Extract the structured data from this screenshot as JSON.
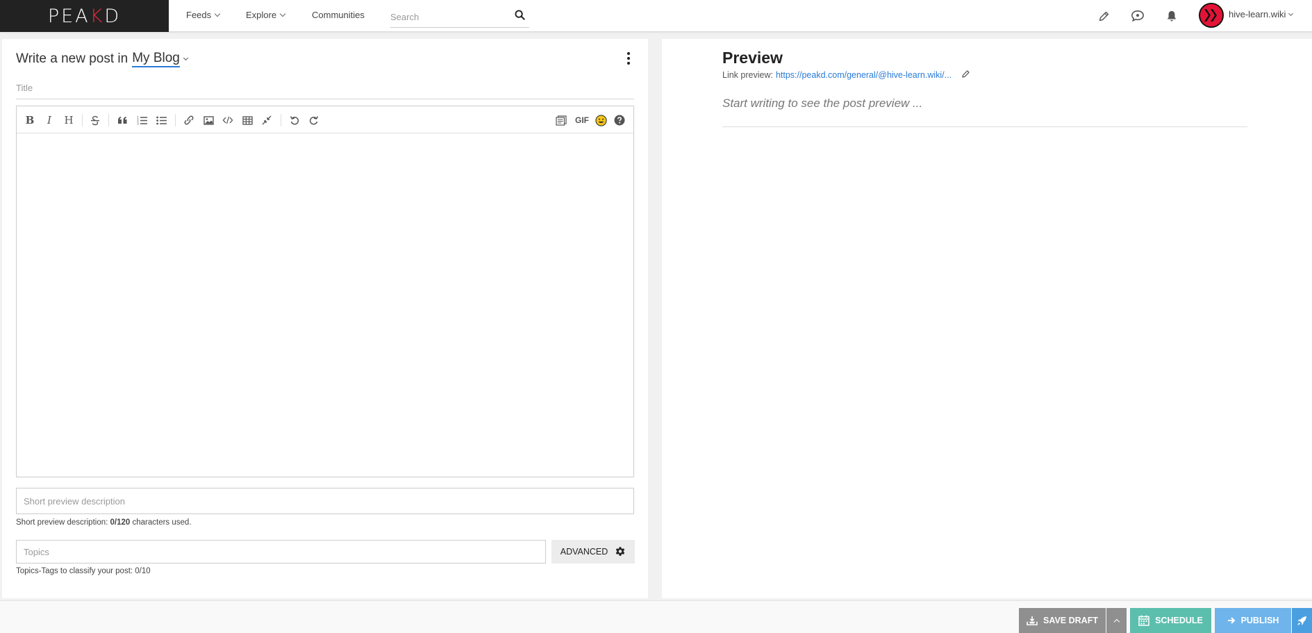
{
  "brand": {
    "logo_prefix": "PE",
    "logo_mark": "A",
    "logo_k": "K",
    "logo_suffix": "D",
    "accent_color": "#e8283d"
  },
  "nav": {
    "items": [
      {
        "label": "Feeds",
        "has_dropdown": true
      },
      {
        "label": "Explore",
        "has_dropdown": true
      },
      {
        "label": "Communities",
        "has_dropdown": false
      }
    ],
    "search_placeholder": "Search",
    "icons": [
      "pencil-icon",
      "chat-icon",
      "bell-icon"
    ],
    "username": "hive-learn.wiki"
  },
  "editor": {
    "heading_prefix": "Write a new post in",
    "blog_target": "My Blog",
    "title_placeholder": "Title",
    "toolbar": [
      "bold",
      "italic",
      "heading",
      "strikethrough",
      "quote",
      "ordered-list",
      "unordered-list",
      "link",
      "image",
      "code",
      "table",
      "fullscreen",
      "undo",
      "redo",
      "snippets",
      "gif",
      "emoji",
      "help"
    ],
    "toolbar_labels": {
      "bold": "B",
      "italic": "I",
      "heading": "H",
      "gif": "GIF"
    },
    "short_desc_placeholder": "Short preview description",
    "short_desc_hint_prefix": "Short preview description:",
    "short_desc_count": "0/120",
    "short_desc_hint_suffix": "characters used.",
    "topics_placeholder": "Topics",
    "topics_hint": "Topics-Tags to classify your post: 0/10",
    "advanced_label": "ADVANCED"
  },
  "preview": {
    "title": "Preview",
    "link_label": "Link preview:",
    "link_url": "https://peakd.com/general/@hive-learn.wiki/...",
    "placeholder": "Start writing to see the post preview ..."
  },
  "actions": {
    "save_draft": "SAVE DRAFT",
    "schedule": "SCHEDULE",
    "publish": "PUBLISH",
    "colors": {
      "save": "#8f8f8f",
      "schedule": "#5cbfae",
      "publish": "#6fb4ea"
    }
  }
}
